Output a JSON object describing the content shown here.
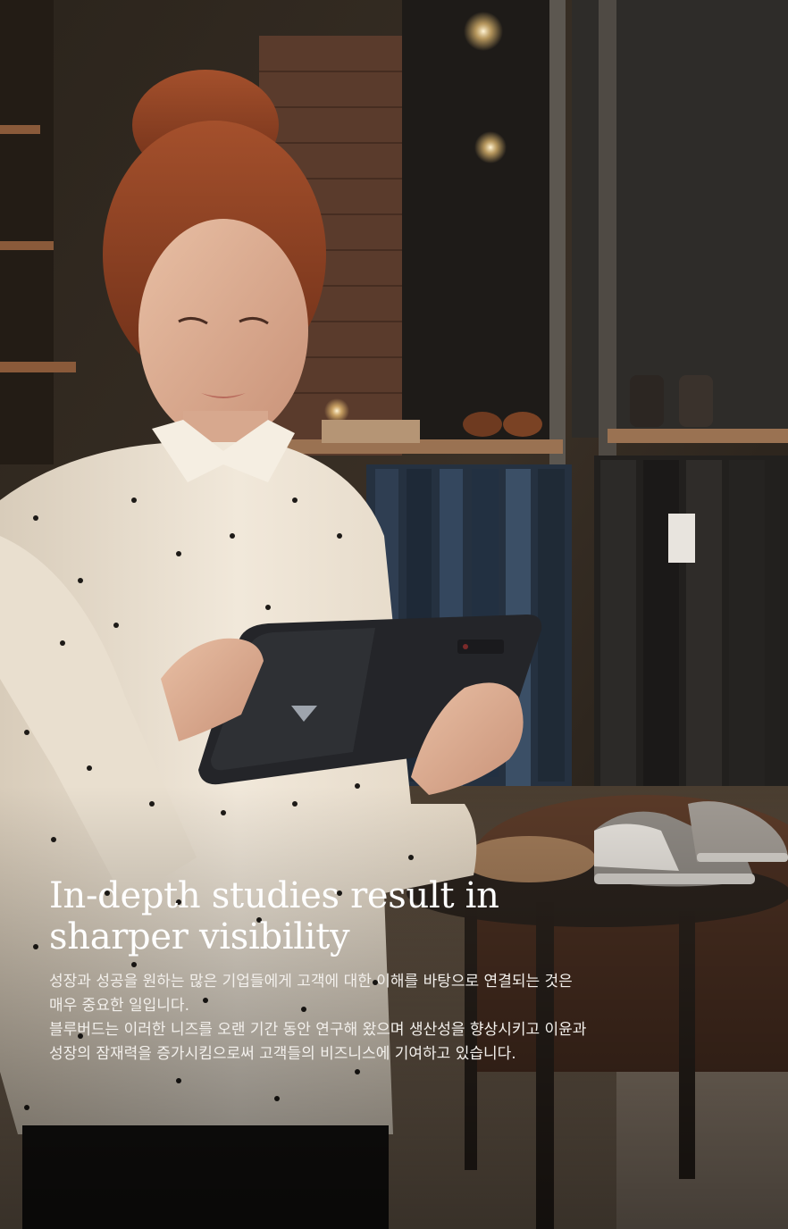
{
  "hero": {
    "headline": "In-depth studies result in sharper visibility",
    "body_lines": [
      "성장과 성공을 원하는 많은 기업들에게 고객에 대한 이해를 바탕으로 연결되는 것은",
      "매우 중요한 일입니다.",
      "블루버드는 이러한 니즈를 오랜 기간 동안 연구해 왔으며 생산성을 향상시키고 이윤과",
      "성장의 잠재력을 증가시킴으로써 고객들의 비즈니스에 기여하고 있습니다."
    ]
  },
  "colors": {
    "text": "#ffffff",
    "shirt": "#efe6d8",
    "tablet": "#2a2b2f",
    "background": "#1b1712"
  },
  "icons": {
    "tablet_logo": "bluebird-logo-icon"
  }
}
